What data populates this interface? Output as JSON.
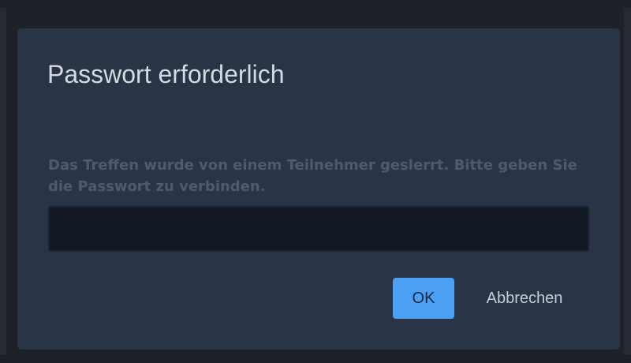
{
  "dialog": {
    "title": "Passwort erforderlich",
    "message": "Das Treffen wurde von einem Teilnehmer geslerrt. Bitte geben Sie die Passwort zu verbinden.",
    "password_value": "",
    "ok_label": "OK",
    "cancel_label": "Abbrechen"
  },
  "colors": {
    "backdrop": "#1e2129",
    "dialog_background": "#293446",
    "title_text": "#d5dae2",
    "message_text": "#4e5b6f",
    "input_background": "#121824",
    "primary_button": "#4aa0f5"
  }
}
